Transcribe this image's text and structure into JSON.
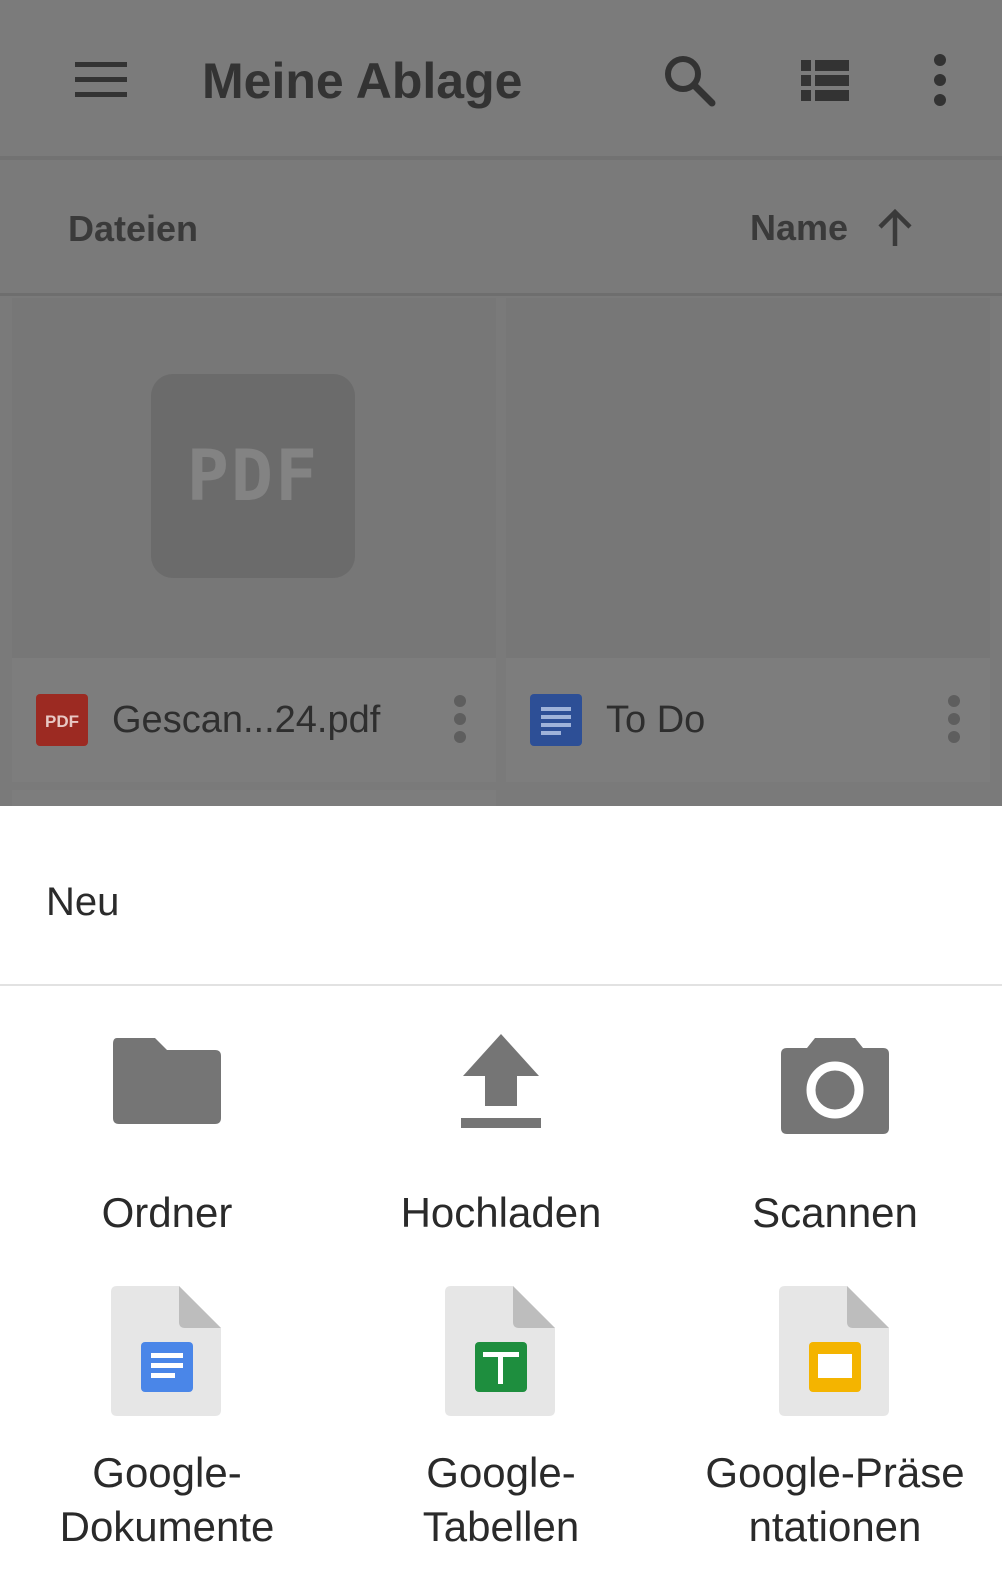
{
  "toolbar": {
    "title": "Meine Ablage",
    "icons": [
      "menu-icon",
      "search-icon",
      "list-view-icon",
      "more-vert-icon"
    ]
  },
  "sort_bar": {
    "section_label": "Dateien",
    "sort_label": "Name",
    "sort_direction_icon": "arrow-upward-icon"
  },
  "files": [
    {
      "name": "Gescan...24.pdf",
      "type_icon": "pdf-file-icon",
      "type_badge": "PDF",
      "preview_label": "PDF"
    },
    {
      "name": "To Do",
      "type_icon": "google-docs-icon"
    }
  ],
  "sheet": {
    "title": "Neu",
    "options": [
      {
        "label": "Ordner",
        "icon": "folder-icon"
      },
      {
        "label": "Hochladen",
        "icon": "upload-icon"
      },
      {
        "label": "Scannen",
        "icon": "camera-icon"
      },
      {
        "label_line1": "Google-",
        "label_line2": "Dokumente",
        "icon": "google-docs-icon"
      },
      {
        "label_line1": "Google-",
        "label_line2": "Tabellen",
        "icon": "google-sheets-icon"
      },
      {
        "label_line1": "Google-Präse",
        "label_line2": "ntationen",
        "icon": "google-slides-icon"
      }
    ]
  },
  "colors": {
    "pdf_red": "#b3261e",
    "docs_blue": "#3d6fd1",
    "sheets_green": "#1e8e3e",
    "slides_yellow": "#f4b400",
    "icon_gray": "#757575",
    "scrim_gray": "#7a7a7a"
  }
}
